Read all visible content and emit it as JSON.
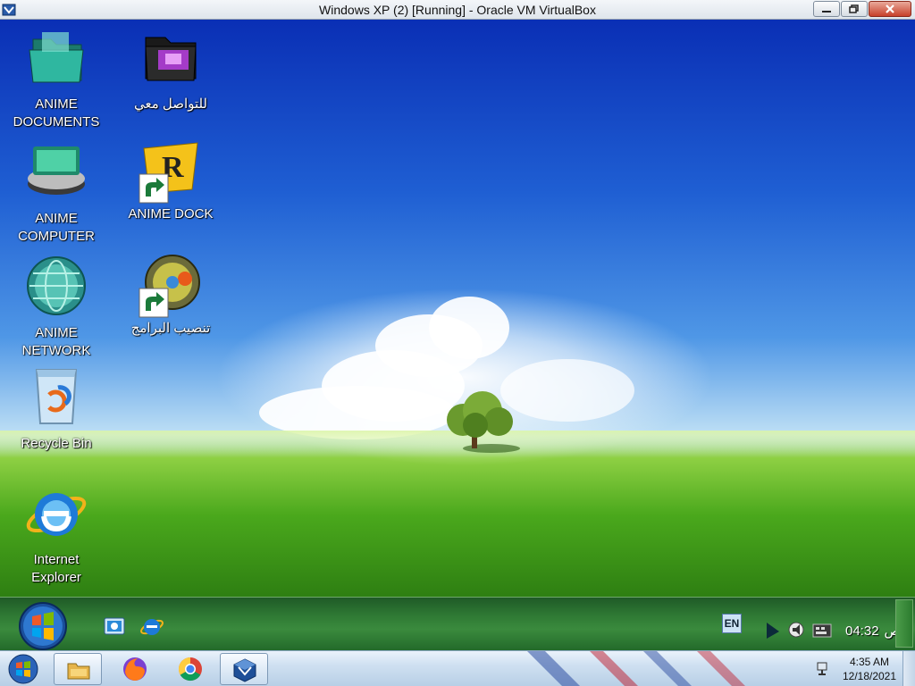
{
  "host_window": {
    "title": "Windows XP (2) [Running] - Oracle VM VirtualBox",
    "icons": {
      "app": "virtualbox-icon",
      "minimize": "minimize-icon",
      "restore": "restore-icon",
      "close": "close-icon"
    }
  },
  "desktop": {
    "icons": [
      {
        "label": "ANIME\nDOCUMENTS",
        "icon": "folder-icon"
      },
      {
        "label": "للتواصل معي",
        "icon": "dark-folder-icon"
      },
      {
        "label": "ANIME\nCOMPUTER",
        "icon": "hard-drive-icon"
      },
      {
        "label": "ANIME DOCK",
        "icon": "rocketdock-icon"
      },
      {
        "label": "ANIME\nNETWORK",
        "icon": "globe-icon"
      },
      {
        "label": "تنصيب البرامج",
        "icon": "installer-icon"
      },
      {
        "label": "Recycle Bin",
        "icon": "recycle-bin-icon"
      },
      {
        "label": "Internet\nExplorer",
        "icon": "internet-explorer-icon"
      }
    ]
  },
  "guest_taskbar": {
    "start_icon": "windows-orb-icon",
    "quick_launch": [
      "show-desktop-icon",
      "internet-explorer-icon"
    ],
    "language": "EN",
    "tray_icons": [
      "expand-arrow-icon",
      "volume-icon",
      "keyboard-layout-icon"
    ],
    "time": "04:32",
    "time_suffix": "ص"
  },
  "host_taskbar": {
    "start_icon": "windows-start-icon",
    "pinned": [
      "file-explorer-icon",
      "firefox-icon",
      "chrome-icon",
      "virtualbox-icon"
    ],
    "time": "4:35 AM",
    "date": "12/18/2021",
    "tray_icons": [
      "network-icon"
    ]
  },
  "colors": {
    "sky_top": "#0a2fb5",
    "grass": "#4aa81c",
    "guest_taskbar": "#2f7a34",
    "host_taskbar": "#cfe0f1"
  }
}
